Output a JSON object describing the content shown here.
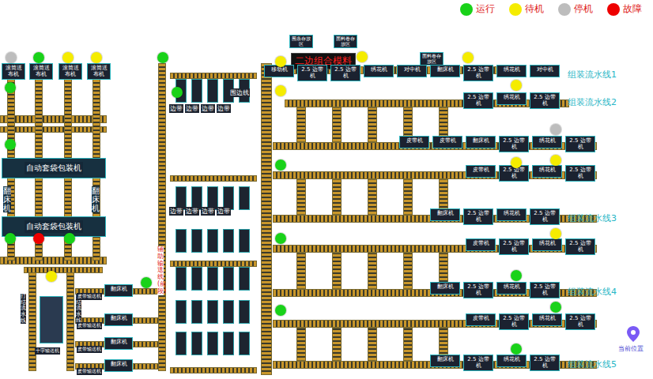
{
  "legend": [
    {
      "key": "running",
      "label": "运行",
      "color": "#19d219"
    },
    {
      "key": "standby",
      "label": "待机",
      "color": "#f5ec00"
    },
    {
      "key": "stopped",
      "label": "停机",
      "color": "#bdbdbd"
    },
    {
      "key": "fault",
      "label": "故障",
      "color": "#ee0000"
    }
  ],
  "feeders": [
    "滚筒送布机",
    "滚筒送布机",
    "滚筒送布机",
    "滚筒送布机"
  ],
  "packers": [
    "自动套袋包装机",
    "自动套袋包装机"
  ],
  "flippers": [
    "翻床机",
    "翻床机"
  ],
  "bottomSides": [
    "打结流水线",
    "打结流水线"
  ],
  "cross": "十字输送机",
  "bottomBelts": [
    "皮带输送机",
    "皮带输送机",
    "皮带输送机",
    "皮带输送机"
  ],
  "bottomMachines": [
    "翻床机",
    "翻床机",
    "翻床机",
    "翻床机"
  ],
  "mainLine": "辅助输送线(前段)",
  "edgeStations": [
    "边带",
    "边带",
    "边带",
    "边带",
    "围边线",
    "边带",
    "边带",
    "边带",
    "边带"
  ],
  "topTags": [
    "围条存放区",
    "面料卷存放区",
    "面料卷存放区"
  ],
  "combo": "二边组合模料",
  "rows": [
    {
      "label": "组装流水线1",
      "machines": [
        "移动机",
        "2.5 边带机",
        "2.5 边带机",
        "绣花机",
        "对中机",
        "翻床机",
        "2.5 边带机",
        "绣花机",
        "对中机"
      ]
    },
    {
      "label": "组装流水线2",
      "machines": [
        "2.5 边带机",
        "绣花机",
        "2.5 边带机"
      ]
    },
    {
      "label": "",
      "machines": [
        "皮带机",
        "皮带机",
        "翻床机",
        "2.5 边带机",
        "绣花机",
        "2.5 边带机"
      ]
    },
    {
      "label": "",
      "machines": [
        "皮带机",
        "2.5 边带机",
        "绣花机",
        "2.5 边带机"
      ]
    },
    {
      "label": "组装流水线3",
      "machines": [
        "翻床机",
        "2.5 边带机",
        "绣花机",
        "2.5 边带机"
      ]
    },
    {
      "label": "",
      "machines": [
        "皮带机",
        "2.5 边带机",
        "绣花机",
        "2.5 边带机"
      ]
    },
    {
      "label": "组装流水线4",
      "machines": [
        "翻床机",
        "2.5 边带机",
        "绣花机",
        "2.5 边带机"
      ]
    },
    {
      "label": "",
      "machines": [
        "皮带机",
        "2.5 边带机",
        "绣花机",
        "2.5 边带机"
      ]
    },
    {
      "label": "组装流水线5",
      "machines": [
        "翻床机",
        "2.5 边带机",
        "绣花机",
        "2.5 边带机"
      ]
    }
  ],
  "indicators": [
    "stopped",
    "running",
    "standby",
    "standby",
    "running",
    "running",
    "running",
    "fault",
    "running",
    "standby",
    "running",
    "running",
    "running",
    "standby",
    "standby",
    "running",
    "running",
    "running",
    "standby",
    "standby",
    "standby",
    "stopped",
    "standby",
    "standby",
    "standby",
    "running",
    "running",
    "running"
  ],
  "pin": {
    "label": "当前位置"
  }
}
